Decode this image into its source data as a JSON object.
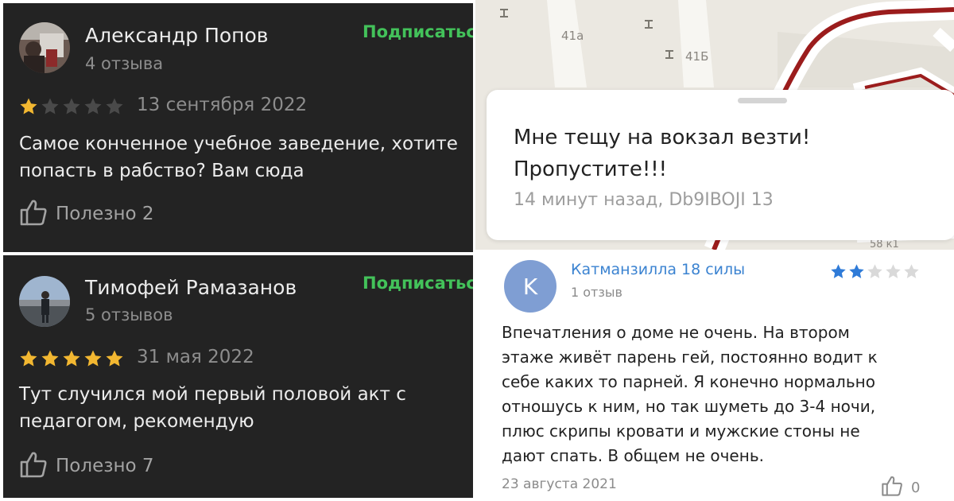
{
  "left_reviews": [
    {
      "name": "Александр Попов",
      "review_count": "4 отзыва",
      "subscribe_label": "Подписаться",
      "rating": 1,
      "max_rating": 5,
      "date": "13 сентября 2022",
      "text": "Самое конченное учебное заведение, хотите\nпопасть в рабство? Вам сюда",
      "useful_label": "Полезно 2"
    },
    {
      "name": "Тимофей Рамазанов",
      "review_count": "5 отзывов",
      "subscribe_label": "Подписаться",
      "rating": 5,
      "max_rating": 5,
      "date": "31 мая 2022",
      "text": "Тут случился мой первый половой акт с\nпедагогом, рекомендую",
      "useful_label": "Полезно 7"
    }
  ],
  "map_comment": {
    "labels": [
      "41а",
      "41Б",
      "58 к1"
    ],
    "text": "Мне тещу на вокзал везти!\nПропустите!!!",
    "meta": "14 минут назад, Db9IBOJI 13"
  },
  "right_review": {
    "avatar_letter": "K",
    "name": "Катманзилла 18 силы",
    "review_count": "1 отзыв",
    "rating": 2,
    "max_rating": 5,
    "text": "Впечатления о доме не очень. На втором\nэтаже живёт парень гей, постоянно водит к\nсебе каких то парней. Я конечно нормально\nотношусь к ним, но так шуметь до 3-4 ночи,\nплюс скрипы кровати и мужские стоны не\nдают спать. В общем не очень.",
    "date": "23 августа 2021",
    "useful_count": "0"
  },
  "colors": {
    "dark_bg": "#232323",
    "subscribe_green": "#43c25a",
    "star_gold": "#f2b731",
    "star_empty_dark": "#4a4a4a",
    "star_blue": "#2f7bd8",
    "star_empty_light": "#d9d9d9",
    "name_blue": "#3b83d1",
    "route_red": "#9b1c1c"
  },
  "icons": [
    "thumbs-up-icon",
    "star-icon",
    "map-pin-icon"
  ]
}
